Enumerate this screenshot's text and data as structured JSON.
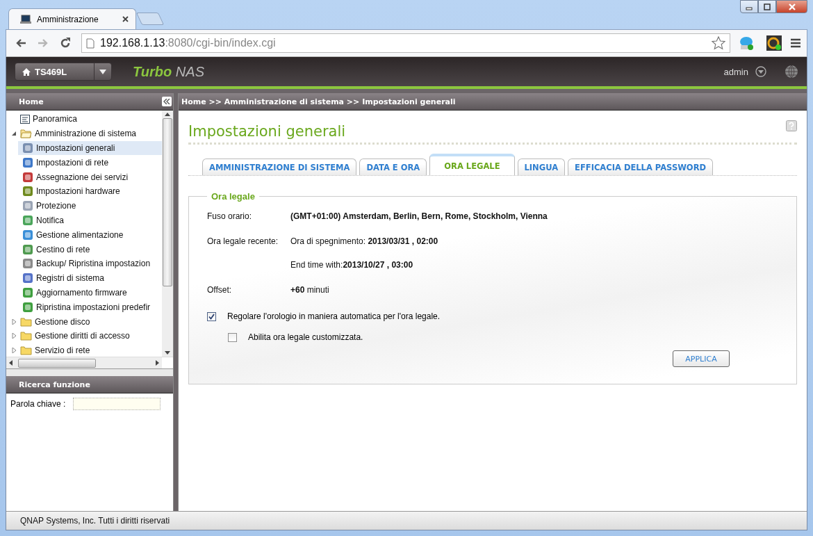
{
  "browser": {
    "tab_title": "Amministrazione",
    "url_host": "192.168.1.13",
    "url_path": ":8080/cgi-bin/index.cgi",
    "nav_buttons": [
      {
        "kind": "back",
        "disabled": false
      },
      {
        "kind": "forward",
        "disabled": true
      },
      {
        "kind": "reload",
        "disabled": false
      }
    ]
  },
  "header": {
    "device": "TS469L",
    "logo": "**Turbo** NAS",
    "user": "admin"
  },
  "sidebar": {
    "title": "Home",
    "items": [
      {
        "kind": "page",
        "label": "Panoramica",
        "selected": false
      },
      {
        "kind": "folder",
        "label": "Amministrazione di sistema",
        "expanded": true,
        "selected": false,
        "children": [
          {
            "kind": "page",
            "label": "Impostazioni generali",
            "selected": true
          },
          {
            "kind": "page",
            "label": "Impostazioni di rete",
            "selected": false
          },
          {
            "kind": "page",
            "label": "Assegnazione dei servizi",
            "selected": false
          },
          {
            "kind": "page",
            "label": "Impostazioni hardware",
            "selected": false
          },
          {
            "kind": "page",
            "label": "Protezione",
            "selected": false
          },
          {
            "kind": "page",
            "label": "Notifica",
            "selected": false
          },
          {
            "kind": "page",
            "label": "Gestione alimentazione",
            "selected": false
          },
          {
            "kind": "page",
            "label": "Cestino di rete",
            "selected": false
          },
          {
            "kind": "page",
            "label": "Backup/ Ripristina impostazion",
            "selected": false
          },
          {
            "kind": "page",
            "label": "Registri di sistema",
            "selected": false
          },
          {
            "kind": "page",
            "label": "Aggiornamento firmware",
            "selected": false
          },
          {
            "kind": "page",
            "label": "Ripristina impostazioni predefir",
            "selected": false
          }
        ]
      },
      {
        "kind": "folder",
        "label": "Gestione disco",
        "expanded": false,
        "selected": false
      },
      {
        "kind": "folder",
        "label": "Gestione diritti di accesso",
        "expanded": false,
        "selected": false
      },
      {
        "kind": "folder",
        "label": "Servizio di rete",
        "expanded": false,
        "selected": false
      }
    ],
    "search": {
      "title": "Ricerca funzione",
      "label": "Parola chiave :"
    }
  },
  "breadcrumb": "Home >> Amministrazione di sistema >> Impostazioni generali",
  "page": {
    "title": "Impostazioni generali",
    "tabs": [
      {
        "label": "AMMINISTRAZIONE DI SISTEMA",
        "selected": false
      },
      {
        "label": "DATA E ORA",
        "selected": false
      },
      {
        "label": "ORA LEGALE",
        "selected": true
      },
      {
        "label": "LINGUA",
        "selected": false
      },
      {
        "label": "EFFICACIA DELLA PASSWORD",
        "selected": false
      }
    ],
    "section": {
      "legend": "Ora legale",
      "rows": [
        {
          "label": "Fuso orario:",
          "bold": true,
          "values": [
            "(GMT+01:00) Amsterdam, Berlin, Bern, Rome, Stockholm, Vienna"
          ]
        },
        {
          "label": "Ora legale recente:",
          "bold": false,
          "values": [
            "Ora di spegnimento: **2013/03/31 , 02:00**",
            "End time with:**2013/10/27 , 03:00**"
          ]
        },
        {
          "label": "Offset:",
          "bold": false,
          "values": [
            "**+60** minuti"
          ]
        }
      ],
      "options": [
        {
          "label": "Regolare l'orologio in maniera automatica per l'ora legale.",
          "checked": true,
          "children": [
            {
              "label": "Abilita ora legale customizzata.",
              "checked": false
            }
          ]
        }
      ],
      "button": "APPLICA"
    }
  },
  "footer": "QNAP Systems, Inc. Tutti i diritti riservati"
}
